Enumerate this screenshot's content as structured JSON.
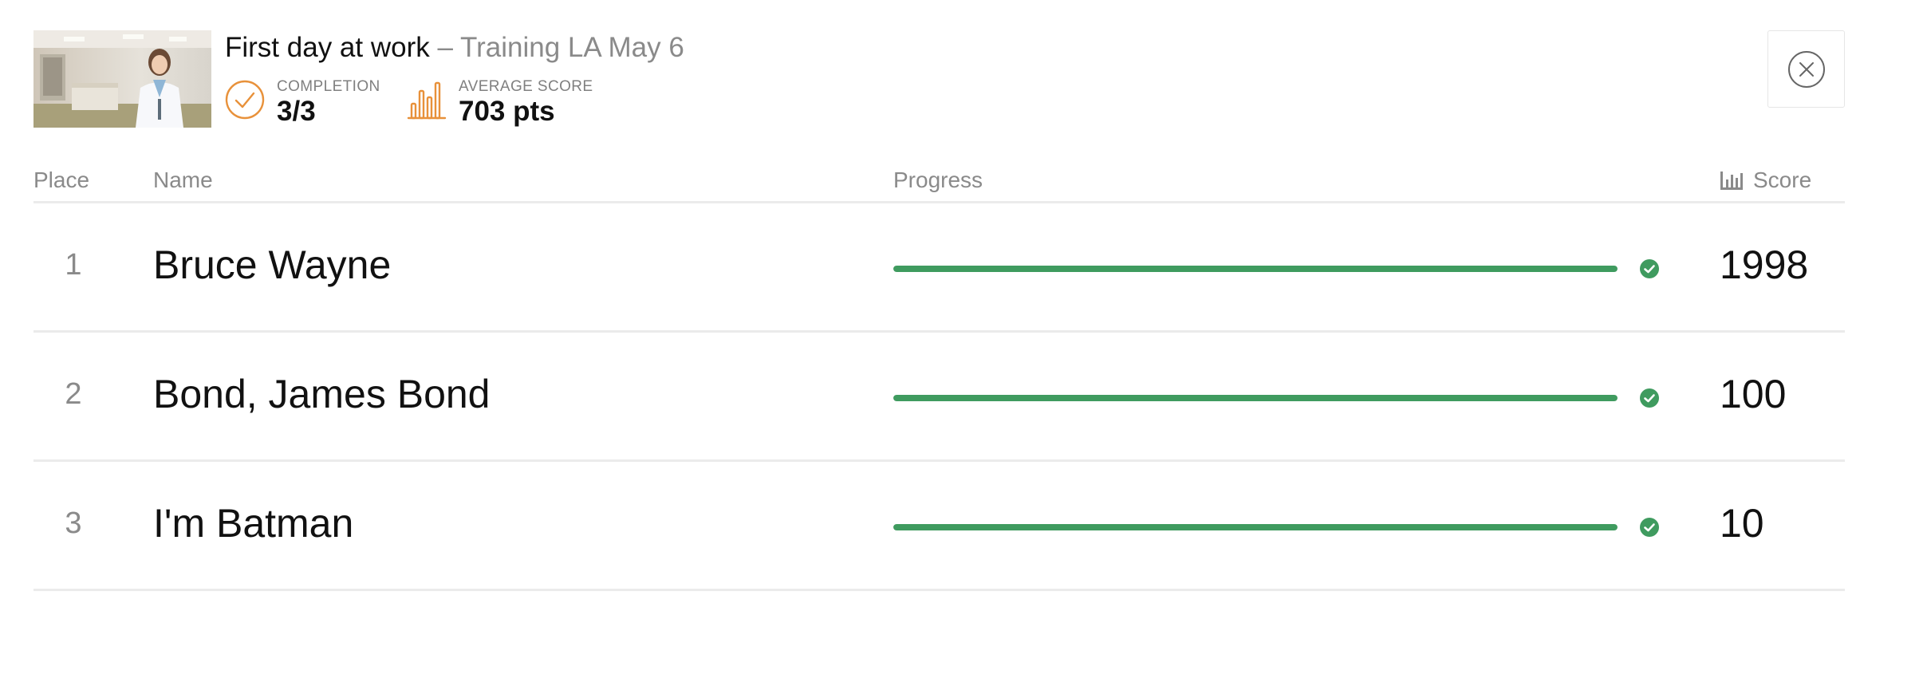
{
  "header": {
    "thumbnail": "doctor-portrait-image",
    "course_title": "First day at work",
    "session_title": " – Training LA May 6",
    "completion_label": "COMPLETION",
    "completion_value": "3/3",
    "average_label": "AVERAGE SCORE",
    "average_value": "703 pts",
    "close_icon": "close-icon",
    "completion_icon": "check-circle-icon",
    "score_icon": "bar-chart-icon"
  },
  "colors": {
    "accent_orange": "#e8913a",
    "progress_green": "#3f9b5f",
    "muted_text": "#8a8a8a"
  },
  "table": {
    "columns": {
      "place": "Place",
      "name": "Name",
      "progress": "Progress",
      "score": "Score"
    },
    "rows": [
      {
        "place": "1",
        "name": "Bruce Wayne",
        "progress": 1.0,
        "complete": true,
        "score": "1998"
      },
      {
        "place": "2",
        "name": "Bond, James Bond",
        "progress": 1.0,
        "complete": true,
        "score": "100"
      },
      {
        "place": "3",
        "name": "I'm Batman",
        "progress": 1.0,
        "complete": true,
        "score": "10"
      }
    ]
  }
}
